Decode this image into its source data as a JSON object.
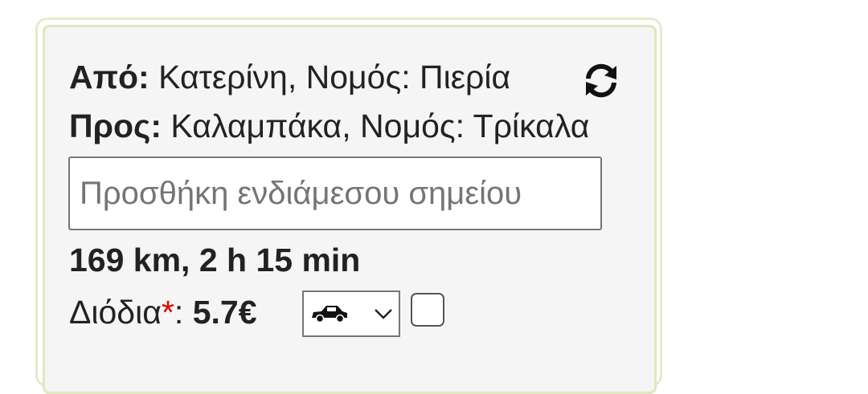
{
  "route": {
    "from_label": "Από:",
    "from_value": " Κατερίνη, Νομός: Πιερία",
    "to_label": "Προς:",
    "to_value": " Καλαμπάκα, Νομός: Τρίκαλα",
    "swap_icon": "refresh-icon"
  },
  "waypoint": {
    "placeholder": "Προσθήκη ενδιάμεσου σημείου",
    "value": ""
  },
  "summary": {
    "distance_duration": "169 km, 2 h 15 min"
  },
  "tolls": {
    "label": "Διόδια",
    "required_mark": "*",
    "separator": ": ",
    "amount": "5.7€",
    "vehicle_icon": "car-icon",
    "checkbox_checked": false
  },
  "colors": {
    "panel_border": "#dfe8bf",
    "panel_bg": "#f5f5f5",
    "required_star": "#e00000"
  }
}
